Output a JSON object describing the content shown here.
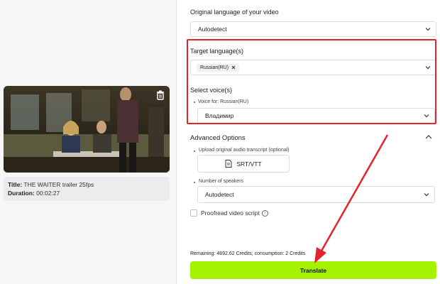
{
  "video": {
    "title_label": "Title:",
    "title_value": "THE WAITER trailer 25fps",
    "duration_label": "Duration:",
    "duration_value": "00:02:27"
  },
  "form": {
    "original_language": {
      "label": "Original language of your video",
      "value": "Autodetect"
    },
    "target_language": {
      "label": "Target language(s)",
      "chip": "Russian(RU)"
    },
    "select_voice": {
      "label": "Select voice(s)",
      "voice_for": "Voice for: Russian(RU)",
      "value": "Владимир"
    },
    "advanced": {
      "label": "Advanced Options",
      "upload_label": "Upload original audio transcript (optional)",
      "upload_button": "SRT/VTT",
      "speakers_label": "Number of speakers",
      "speakers_value": "Autodetect",
      "proofread_label": "Proofread video script",
      "info_glyph": "!"
    },
    "credits": "Remaining: 4692.62 Credits; consumption: 2 Credits",
    "translate_button": "Translate"
  },
  "colors": {
    "highlight_box": "#e3252b",
    "translate_button": "#a4f200",
    "arrow": "#e3252b"
  },
  "icons": {
    "delete": "trash-icon",
    "dropdown": "chevron-down-icon",
    "collapse": "chevron-up-icon",
    "file": "file-icon",
    "remove_chip": "close-icon",
    "info": "info-icon"
  }
}
